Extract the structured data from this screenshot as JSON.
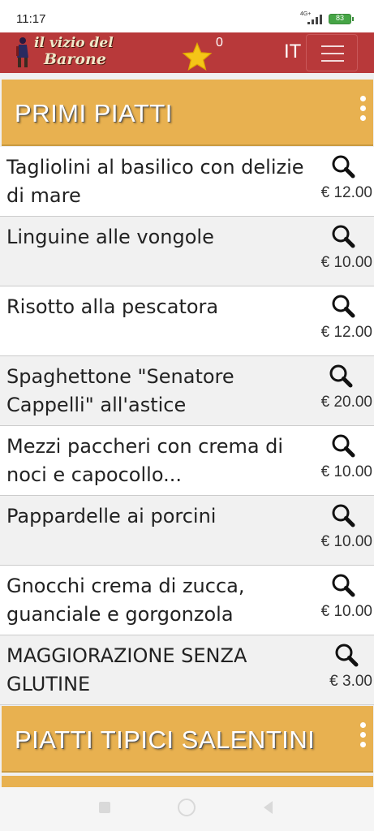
{
  "status_bar": {
    "time": "11:17",
    "network": "4G+",
    "battery": "83"
  },
  "header": {
    "logo_line1": "il vizio del",
    "logo_line2": "Barone",
    "favorites_count": "0",
    "language": "IT",
    "menu_icon": "hamburger-icon",
    "star_icon": "star-icon",
    "colors": {
      "header_bg": "#b8393a",
      "star": "#f5c518"
    }
  },
  "categories": [
    {
      "title": "PRIMI PIATTI",
      "items": [
        {
          "name": "Tagliolini al basilico con delizie di mare",
          "price": "€ 12.00"
        },
        {
          "name": "Linguine alle vongole",
          "price": "€ 10.00"
        },
        {
          "name": "Risotto alla pescatora",
          "price": "€ 12.00"
        },
        {
          "name": "Spaghettone \"Senatore Cappelli\" all'astice",
          "price": "€ 20.00"
        },
        {
          "name": "Mezzi paccheri con crema di noci e capocollo...",
          "price": "€ 10.00"
        },
        {
          "name": "Pappardelle ai porcini",
          "price": "€ 10.00"
        },
        {
          "name": "Gnocchi crema di zucca, guanciale e gorgonzola",
          "price": "€ 10.00"
        },
        {
          "name": "MAGGIORAZIONE SENZA GLUTINE",
          "price": "€ 3.00"
        }
      ]
    },
    {
      "title": "PIATTI TIPICI SALENTINI",
      "items": []
    }
  ],
  "icons": {
    "item_detail": "magnifier-icon",
    "category_menu": "kebab-menu-icon"
  },
  "colors": {
    "category_bg": "#e8b150"
  }
}
